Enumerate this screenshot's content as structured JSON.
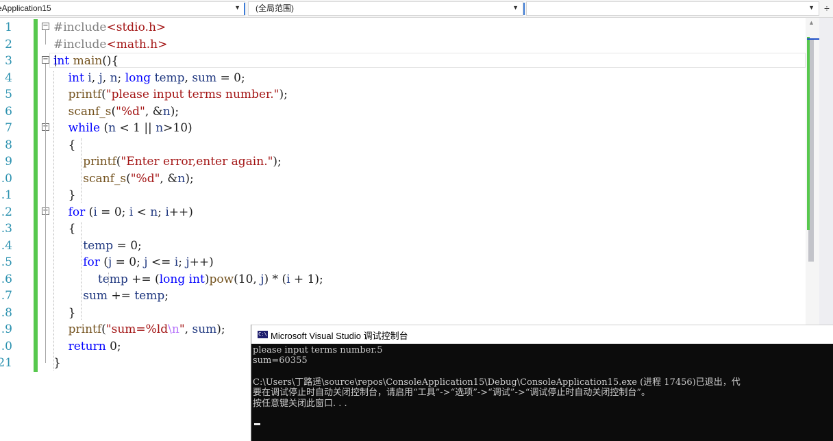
{
  "navbar": {
    "project_combo": "eApplication15",
    "scope_combo": "(全局范围)",
    "member_combo": "",
    "split_button": "÷"
  },
  "editor": {
    "line_numbers": [
      "1",
      "2",
      "3",
      "4",
      "5",
      "6",
      "7",
      "8",
      "9",
      ".0",
      ".1",
      ".2",
      ".3",
      ".4",
      ".5",
      ".6",
      ".7",
      ".8",
      ".9",
      ".0",
      "21"
    ],
    "lines": [
      [
        [
          "pp",
          "#include"
        ],
        [
          "str",
          "<stdio.h>"
        ]
      ],
      [
        [
          "pp",
          "#include"
        ],
        [
          "str",
          "<math.h>"
        ]
      ],
      [
        [
          "kw",
          "int"
        ],
        [
          "plain",
          " "
        ],
        [
          "fn",
          "main"
        ],
        [
          "plain",
          "(){"
        ]
      ],
      [
        [
          "plain",
          "    "
        ],
        [
          "kw",
          "int"
        ],
        [
          "plain",
          " "
        ],
        [
          "var",
          "i"
        ],
        [
          "plain",
          ", "
        ],
        [
          "var",
          "j"
        ],
        [
          "plain",
          ", "
        ],
        [
          "var",
          "n"
        ],
        [
          "plain",
          "; "
        ],
        [
          "kw",
          "long"
        ],
        [
          "plain",
          " "
        ],
        [
          "var",
          "temp"
        ],
        [
          "plain",
          ", "
        ],
        [
          "var",
          "sum"
        ],
        [
          "plain",
          " = 0;"
        ]
      ],
      [
        [
          "plain",
          "    "
        ],
        [
          "fn",
          "printf"
        ],
        [
          "plain",
          "("
        ],
        [
          "str",
          "\"please input terms number.\""
        ],
        [
          "plain",
          ");"
        ]
      ],
      [
        [
          "plain",
          "    "
        ],
        [
          "fn",
          "scanf_s"
        ],
        [
          "plain",
          "("
        ],
        [
          "str",
          "\"%d\""
        ],
        [
          "plain",
          ", &"
        ],
        [
          "var",
          "n"
        ],
        [
          "plain",
          ");"
        ]
      ],
      [
        [
          "plain",
          "    "
        ],
        [
          "kw",
          "while"
        ],
        [
          "plain",
          " ("
        ],
        [
          "var",
          "n"
        ],
        [
          "plain",
          " < 1 || "
        ],
        [
          "var",
          "n"
        ],
        [
          "plain",
          ">10)"
        ]
      ],
      [
        [
          "plain",
          "    {"
        ]
      ],
      [
        [
          "plain",
          "        "
        ],
        [
          "fn",
          "printf"
        ],
        [
          "plain",
          "("
        ],
        [
          "str",
          "\"Enter error,enter again.\""
        ],
        [
          "plain",
          ");"
        ]
      ],
      [
        [
          "plain",
          "        "
        ],
        [
          "fn",
          "scanf_s"
        ],
        [
          "plain",
          "("
        ],
        [
          "str",
          "\"%d\""
        ],
        [
          "plain",
          ", &"
        ],
        [
          "var",
          "n"
        ],
        [
          "plain",
          ");"
        ]
      ],
      [
        [
          "plain",
          "    }"
        ]
      ],
      [
        [
          "plain",
          "    "
        ],
        [
          "kw",
          "for"
        ],
        [
          "plain",
          " ("
        ],
        [
          "var",
          "i"
        ],
        [
          "plain",
          " = 0; "
        ],
        [
          "var",
          "i"
        ],
        [
          "plain",
          " < "
        ],
        [
          "var",
          "n"
        ],
        [
          "plain",
          "; "
        ],
        [
          "var",
          "i"
        ],
        [
          "plain",
          "++)"
        ]
      ],
      [
        [
          "plain",
          "    {"
        ]
      ],
      [
        [
          "plain",
          "        "
        ],
        [
          "var",
          "temp"
        ],
        [
          "plain",
          " = 0;"
        ]
      ],
      [
        [
          "plain",
          "        "
        ],
        [
          "kw",
          "for"
        ],
        [
          "plain",
          " ("
        ],
        [
          "var",
          "j"
        ],
        [
          "plain",
          " = 0; "
        ],
        [
          "var",
          "j"
        ],
        [
          "plain",
          " <= "
        ],
        [
          "var",
          "i"
        ],
        [
          "plain",
          "; "
        ],
        [
          "var",
          "j"
        ],
        [
          "plain",
          "++)"
        ]
      ],
      [
        [
          "plain",
          "            "
        ],
        [
          "var",
          "temp"
        ],
        [
          "plain",
          " += ("
        ],
        [
          "kw",
          "long int"
        ],
        [
          "plain",
          ")"
        ],
        [
          "fn",
          "pow"
        ],
        [
          "plain",
          "(10, "
        ],
        [
          "var",
          "j"
        ],
        [
          "plain",
          ") * ("
        ],
        [
          "var",
          "i"
        ],
        [
          "plain",
          " + 1);"
        ]
      ],
      [
        [
          "plain",
          "        "
        ],
        [
          "var",
          "sum"
        ],
        [
          "plain",
          " += "
        ],
        [
          "var",
          "temp"
        ],
        [
          "plain",
          ";"
        ]
      ],
      [
        [
          "plain",
          "    }"
        ]
      ],
      [
        [
          "plain",
          "    "
        ],
        [
          "fn",
          "printf"
        ],
        [
          "plain",
          "("
        ],
        [
          "str",
          "\"sum=%ld"
        ],
        [
          "esc",
          "\\n"
        ],
        [
          "str",
          "\""
        ],
        [
          "plain",
          ", "
        ],
        [
          "var",
          "sum"
        ],
        [
          "plain",
          ");"
        ]
      ],
      [
        [
          "plain",
          "    "
        ],
        [
          "kw",
          "return"
        ],
        [
          "plain",
          " 0;"
        ]
      ],
      [
        [
          "plain",
          "}"
        ]
      ]
    ]
  },
  "console": {
    "title": "Microsoft Visual Studio 调试控制台",
    "icon_label": "C:\\",
    "lines": [
      "please input terms number.5",
      "sum=60355",
      "",
      "C:\\Users\\丁路遥\\source\\repos\\ConsoleApplication15\\Debug\\ConsoleApplication15.exe (进程 17456)已退出，代",
      "要在调试停止时自动关闭控制台，请启用“工具”->“选项”->“调试”->“调试停止时自动关闭控制台”。",
      "按任意键关闭此窗口. . ."
    ]
  },
  "colors": {
    "keyword": "#0000ff",
    "preprocessor": "#808080",
    "string": "#a31515",
    "function": "#74531f",
    "variable": "#1f377f",
    "line_number": "#2b91af",
    "change_bar": "#57c84d",
    "console_bg": "#0c0c0c"
  }
}
